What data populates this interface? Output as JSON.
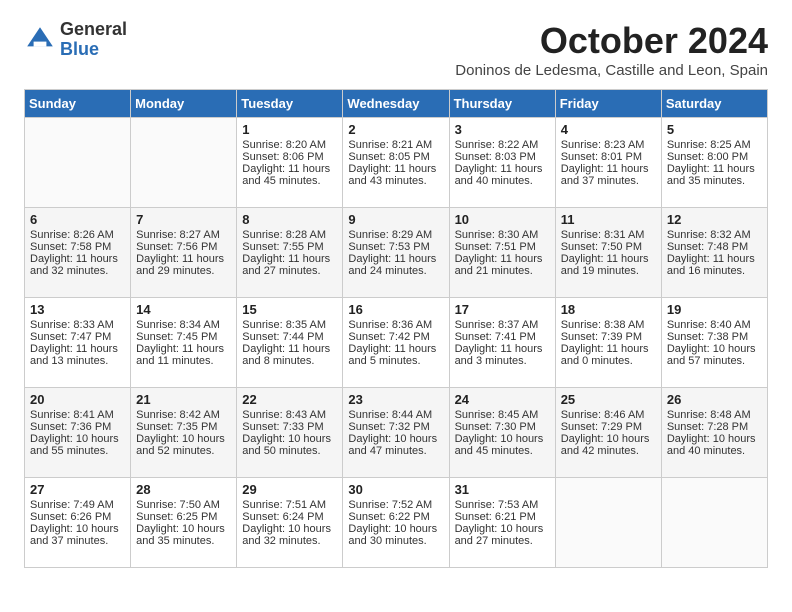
{
  "header": {
    "logo_general": "General",
    "logo_blue": "Blue",
    "month": "October 2024",
    "location": "Doninos de Ledesma, Castille and Leon, Spain"
  },
  "days_of_week": [
    "Sunday",
    "Monday",
    "Tuesday",
    "Wednesday",
    "Thursday",
    "Friday",
    "Saturday"
  ],
  "weeks": [
    [
      {
        "day": null
      },
      {
        "day": null
      },
      {
        "day": "1",
        "sunrise": "Sunrise: 8:20 AM",
        "sunset": "Sunset: 8:06 PM",
        "daylight": "Daylight: 11 hours and 45 minutes."
      },
      {
        "day": "2",
        "sunrise": "Sunrise: 8:21 AM",
        "sunset": "Sunset: 8:05 PM",
        "daylight": "Daylight: 11 hours and 43 minutes."
      },
      {
        "day": "3",
        "sunrise": "Sunrise: 8:22 AM",
        "sunset": "Sunset: 8:03 PM",
        "daylight": "Daylight: 11 hours and 40 minutes."
      },
      {
        "day": "4",
        "sunrise": "Sunrise: 8:23 AM",
        "sunset": "Sunset: 8:01 PM",
        "daylight": "Daylight: 11 hours and 37 minutes."
      },
      {
        "day": "5",
        "sunrise": "Sunrise: 8:25 AM",
        "sunset": "Sunset: 8:00 PM",
        "daylight": "Daylight: 11 hours and 35 minutes."
      }
    ],
    [
      {
        "day": "6",
        "sunrise": "Sunrise: 8:26 AM",
        "sunset": "Sunset: 7:58 PM",
        "daylight": "Daylight: 11 hours and 32 minutes."
      },
      {
        "day": "7",
        "sunrise": "Sunrise: 8:27 AM",
        "sunset": "Sunset: 7:56 PM",
        "daylight": "Daylight: 11 hours and 29 minutes."
      },
      {
        "day": "8",
        "sunrise": "Sunrise: 8:28 AM",
        "sunset": "Sunset: 7:55 PM",
        "daylight": "Daylight: 11 hours and 27 minutes."
      },
      {
        "day": "9",
        "sunrise": "Sunrise: 8:29 AM",
        "sunset": "Sunset: 7:53 PM",
        "daylight": "Daylight: 11 hours and 24 minutes."
      },
      {
        "day": "10",
        "sunrise": "Sunrise: 8:30 AM",
        "sunset": "Sunset: 7:51 PM",
        "daylight": "Daylight: 11 hours and 21 minutes."
      },
      {
        "day": "11",
        "sunrise": "Sunrise: 8:31 AM",
        "sunset": "Sunset: 7:50 PM",
        "daylight": "Daylight: 11 hours and 19 minutes."
      },
      {
        "day": "12",
        "sunrise": "Sunrise: 8:32 AM",
        "sunset": "Sunset: 7:48 PM",
        "daylight": "Daylight: 11 hours and 16 minutes."
      }
    ],
    [
      {
        "day": "13",
        "sunrise": "Sunrise: 8:33 AM",
        "sunset": "Sunset: 7:47 PM",
        "daylight": "Daylight: 11 hours and 13 minutes."
      },
      {
        "day": "14",
        "sunrise": "Sunrise: 8:34 AM",
        "sunset": "Sunset: 7:45 PM",
        "daylight": "Daylight: 11 hours and 11 minutes."
      },
      {
        "day": "15",
        "sunrise": "Sunrise: 8:35 AM",
        "sunset": "Sunset: 7:44 PM",
        "daylight": "Daylight: 11 hours and 8 minutes."
      },
      {
        "day": "16",
        "sunrise": "Sunrise: 8:36 AM",
        "sunset": "Sunset: 7:42 PM",
        "daylight": "Daylight: 11 hours and 5 minutes."
      },
      {
        "day": "17",
        "sunrise": "Sunrise: 8:37 AM",
        "sunset": "Sunset: 7:41 PM",
        "daylight": "Daylight: 11 hours and 3 minutes."
      },
      {
        "day": "18",
        "sunrise": "Sunrise: 8:38 AM",
        "sunset": "Sunset: 7:39 PM",
        "daylight": "Daylight: 11 hours and 0 minutes."
      },
      {
        "day": "19",
        "sunrise": "Sunrise: 8:40 AM",
        "sunset": "Sunset: 7:38 PM",
        "daylight": "Daylight: 10 hours and 57 minutes."
      }
    ],
    [
      {
        "day": "20",
        "sunrise": "Sunrise: 8:41 AM",
        "sunset": "Sunset: 7:36 PM",
        "daylight": "Daylight: 10 hours and 55 minutes."
      },
      {
        "day": "21",
        "sunrise": "Sunrise: 8:42 AM",
        "sunset": "Sunset: 7:35 PM",
        "daylight": "Daylight: 10 hours and 52 minutes."
      },
      {
        "day": "22",
        "sunrise": "Sunrise: 8:43 AM",
        "sunset": "Sunset: 7:33 PM",
        "daylight": "Daylight: 10 hours and 50 minutes."
      },
      {
        "day": "23",
        "sunrise": "Sunrise: 8:44 AM",
        "sunset": "Sunset: 7:32 PM",
        "daylight": "Daylight: 10 hours and 47 minutes."
      },
      {
        "day": "24",
        "sunrise": "Sunrise: 8:45 AM",
        "sunset": "Sunset: 7:30 PM",
        "daylight": "Daylight: 10 hours and 45 minutes."
      },
      {
        "day": "25",
        "sunrise": "Sunrise: 8:46 AM",
        "sunset": "Sunset: 7:29 PM",
        "daylight": "Daylight: 10 hours and 42 minutes."
      },
      {
        "day": "26",
        "sunrise": "Sunrise: 8:48 AM",
        "sunset": "Sunset: 7:28 PM",
        "daylight": "Daylight: 10 hours and 40 minutes."
      }
    ],
    [
      {
        "day": "27",
        "sunrise": "Sunrise: 7:49 AM",
        "sunset": "Sunset: 6:26 PM",
        "daylight": "Daylight: 10 hours and 37 minutes."
      },
      {
        "day": "28",
        "sunrise": "Sunrise: 7:50 AM",
        "sunset": "Sunset: 6:25 PM",
        "daylight": "Daylight: 10 hours and 35 minutes."
      },
      {
        "day": "29",
        "sunrise": "Sunrise: 7:51 AM",
        "sunset": "Sunset: 6:24 PM",
        "daylight": "Daylight: 10 hours and 32 minutes."
      },
      {
        "day": "30",
        "sunrise": "Sunrise: 7:52 AM",
        "sunset": "Sunset: 6:22 PM",
        "daylight": "Daylight: 10 hours and 30 minutes."
      },
      {
        "day": "31",
        "sunrise": "Sunrise: 7:53 AM",
        "sunset": "Sunset: 6:21 PM",
        "daylight": "Daylight: 10 hours and 27 minutes."
      },
      {
        "day": null
      },
      {
        "day": null
      }
    ]
  ]
}
